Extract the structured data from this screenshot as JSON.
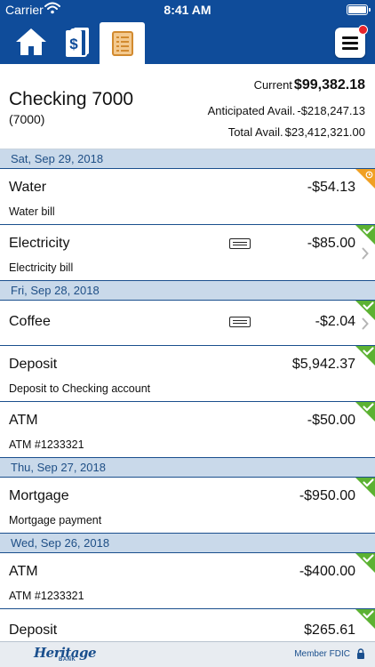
{
  "status_bar": {
    "carrier": "Carrier",
    "time": "8:41 AM"
  },
  "nav": {
    "tabs": [
      "home-icon",
      "accounts-icon",
      "transactions-icon"
    ],
    "active_tab": "transactions-icon",
    "menu_icon": "hamburger-menu-icon"
  },
  "account": {
    "name": "Checking 7000",
    "number": "(7000)",
    "current_label": "Current",
    "current_amount": "$99,382.18",
    "anticipated_label": "Anticipated Avail.",
    "anticipated_amount": "-$218,247.13",
    "total_label": "Total Avail.",
    "total_amount": "$23,412,321.00"
  },
  "groups": [
    {
      "date": "Sat, Sep 29, 2018",
      "transactions": [
        {
          "title": "Water",
          "amount": "-$54.13",
          "description": "Water bill",
          "status": "pending",
          "receipt": false,
          "chevron": false
        },
        {
          "title": "Electricity",
          "amount": "-$85.00",
          "description": "Electricity bill",
          "status": "cleared",
          "receipt": true,
          "chevron": true
        }
      ]
    },
    {
      "date": "Fri, Sep 28, 2018",
      "transactions": [
        {
          "title": "Coffee",
          "amount": "-$2.04",
          "description": "",
          "status": "cleared",
          "receipt": true,
          "chevron": true
        },
        {
          "title": "Deposit",
          "amount": "$5,942.37",
          "description": "Deposit to Checking account",
          "status": "cleared",
          "receipt": false,
          "chevron": false
        },
        {
          "title": "ATM",
          "amount": "-$50.00",
          "description": "ATM #1233321",
          "status": "cleared",
          "receipt": false,
          "chevron": false
        }
      ]
    },
    {
      "date": "Thu, Sep 27, 2018",
      "transactions": [
        {
          "title": "Mortgage",
          "amount": "-$950.00",
          "description": "Mortgage payment",
          "status": "cleared",
          "receipt": false,
          "chevron": false
        }
      ]
    },
    {
      "date": "Wed, Sep 26, 2018",
      "transactions": [
        {
          "title": "ATM",
          "amount": "-$400.00",
          "description": "ATM #1233321",
          "status": "cleared",
          "receipt": false,
          "chevron": false
        },
        {
          "title": "Deposit",
          "amount": "$265.61",
          "description": "",
          "status": "cleared",
          "receipt": false,
          "chevron": false
        }
      ]
    }
  ],
  "footer": {
    "logo_text": "Heritage",
    "logo_subtext": "BANK",
    "fdic_text": "Member FDIC"
  },
  "colors": {
    "brand_blue": "#0f4c9a",
    "date_header_bg": "#c9d9ea",
    "cleared_green": "#5cb232",
    "pending_orange": "#f0a023"
  }
}
